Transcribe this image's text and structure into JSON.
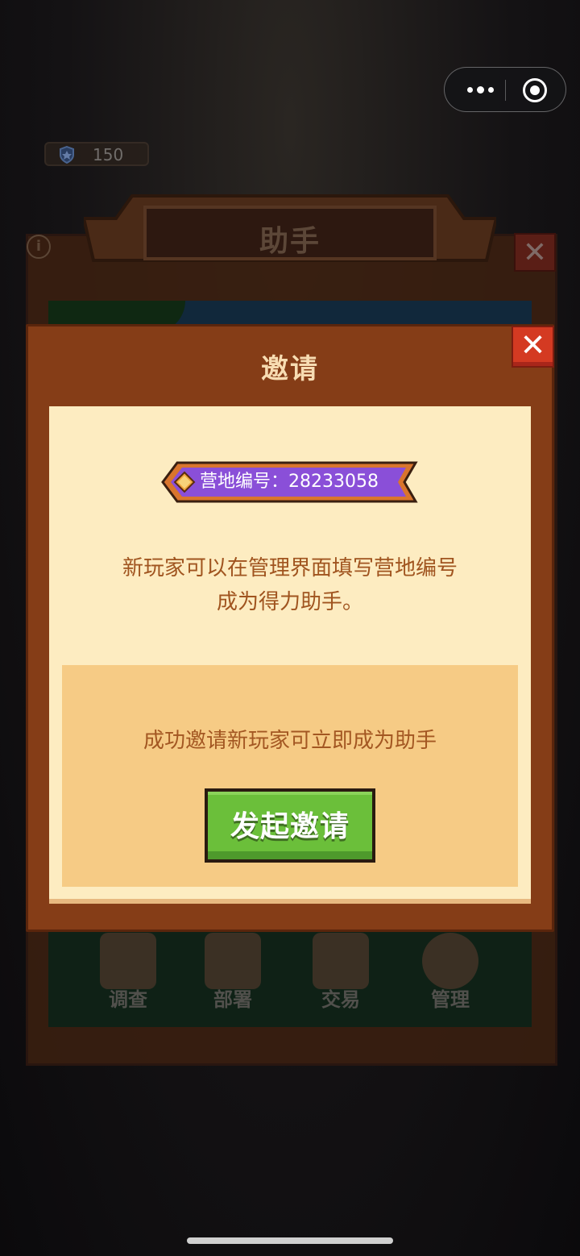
{
  "topbar": {
    "more_icon": "more-dots-icon",
    "target_icon": "record-target-icon"
  },
  "score": {
    "value": "150",
    "icon": "shield-icon"
  },
  "back_panel": {
    "title": "助手",
    "info_icon": "info-icon",
    "close_label": "✕",
    "nav": [
      {
        "label": "调查",
        "icon": "magnifier-clipboard-icon"
      },
      {
        "label": "部署",
        "icon": "map-pin-icon"
      },
      {
        "label": "交易",
        "icon": "trade-cart-icon"
      },
      {
        "label": "管理",
        "icon": "gear-icon"
      }
    ]
  },
  "modal": {
    "title": "邀请",
    "close_label": "✕",
    "camp_id_label": "营地编号：28233058",
    "desc_line1": "新玩家可以在管理界面填写营地编号",
    "desc_line2": "成为得力助手。",
    "box_text": "成功邀请新玩家可立即成为助手",
    "invite_button": "发起邀请"
  },
  "colors": {
    "modal_bg": "#853d17",
    "inner_bg": "#fdecc1",
    "box_bg": "#f6cb85",
    "text_brown": "#a0541f",
    "badge_purple": "#8a4fd8",
    "button_green": "#6bbf3a",
    "close_red": "#d43a22"
  }
}
